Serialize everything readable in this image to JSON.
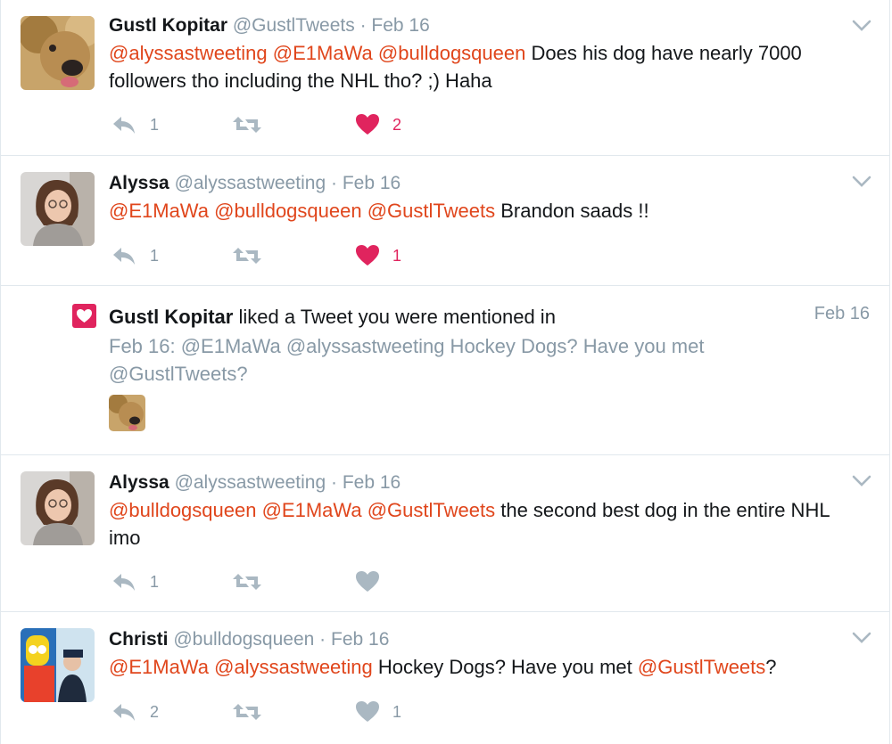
{
  "tweets": [
    {
      "name": "Gustl Kopitar",
      "handle": "@GustlTweets",
      "dot": "·",
      "date": "Feb 16",
      "text": [
        {
          "m": "@alyssastweeting"
        },
        {
          "t": " "
        },
        {
          "m": "@E1MaWa"
        },
        {
          "t": " "
        },
        {
          "m": "@bulldogsqueen"
        },
        {
          "t": " Does his dog have nearly 7000 followers tho including the NHL tho? ;) Haha"
        }
      ],
      "reply_count": "1",
      "like_count": "2",
      "liked": true
    },
    {
      "name": "Alyssa",
      "handle": "@alyssastweeting",
      "dot": "·",
      "date": "Feb 16",
      "text": [
        {
          "m": "@E1MaWa"
        },
        {
          "t": " "
        },
        {
          "m": "@bulldogsqueen"
        },
        {
          "t": " "
        },
        {
          "m": "@GustlTweets"
        },
        {
          "t": " Brandon saads !!"
        }
      ],
      "reply_count": "1",
      "like_count": "1",
      "liked": true
    },
    {
      "name": "Alyssa",
      "handle": "@alyssastweeting",
      "dot": "·",
      "date": "Feb 16",
      "text": [
        {
          "m": "@bulldogsqueen"
        },
        {
          "t": " "
        },
        {
          "m": "@E1MaWa"
        },
        {
          "t": " "
        },
        {
          "m": "@GustlTweets"
        },
        {
          "t": " the second best dog in the entire NHL imo"
        }
      ],
      "reply_count": "1",
      "like_count": "",
      "liked": false
    },
    {
      "name": "Christi",
      "handle": "@bulldogsqueen",
      "dot": "·",
      "date": "Feb 16",
      "text": [
        {
          "m": "@E1MaWa"
        },
        {
          "t": " "
        },
        {
          "m": "@alyssastweeting"
        },
        {
          "t": " Hockey Dogs? Have you met "
        },
        {
          "m": "@GustlTweets"
        },
        {
          "t": "?"
        }
      ],
      "reply_count": "2",
      "like_count": "1",
      "liked": false
    }
  ],
  "notification": {
    "actor": "Gustl Kopitar",
    "action": " liked a Tweet you were mentioned in",
    "date": "Feb 16",
    "quote": "Feb 16: @E1MaWa @alyssastweeting Hockey Dogs? Have you met @GustlTweets?"
  },
  "colors": {
    "mention": "#e0461c",
    "like_active": "#e0245e",
    "muted": "#8899a6",
    "icon": "#aab8c2"
  },
  "icons": [
    "chevron-down-icon",
    "reply-icon",
    "retweet-icon",
    "heart-icon",
    "heart-notification-icon"
  ]
}
